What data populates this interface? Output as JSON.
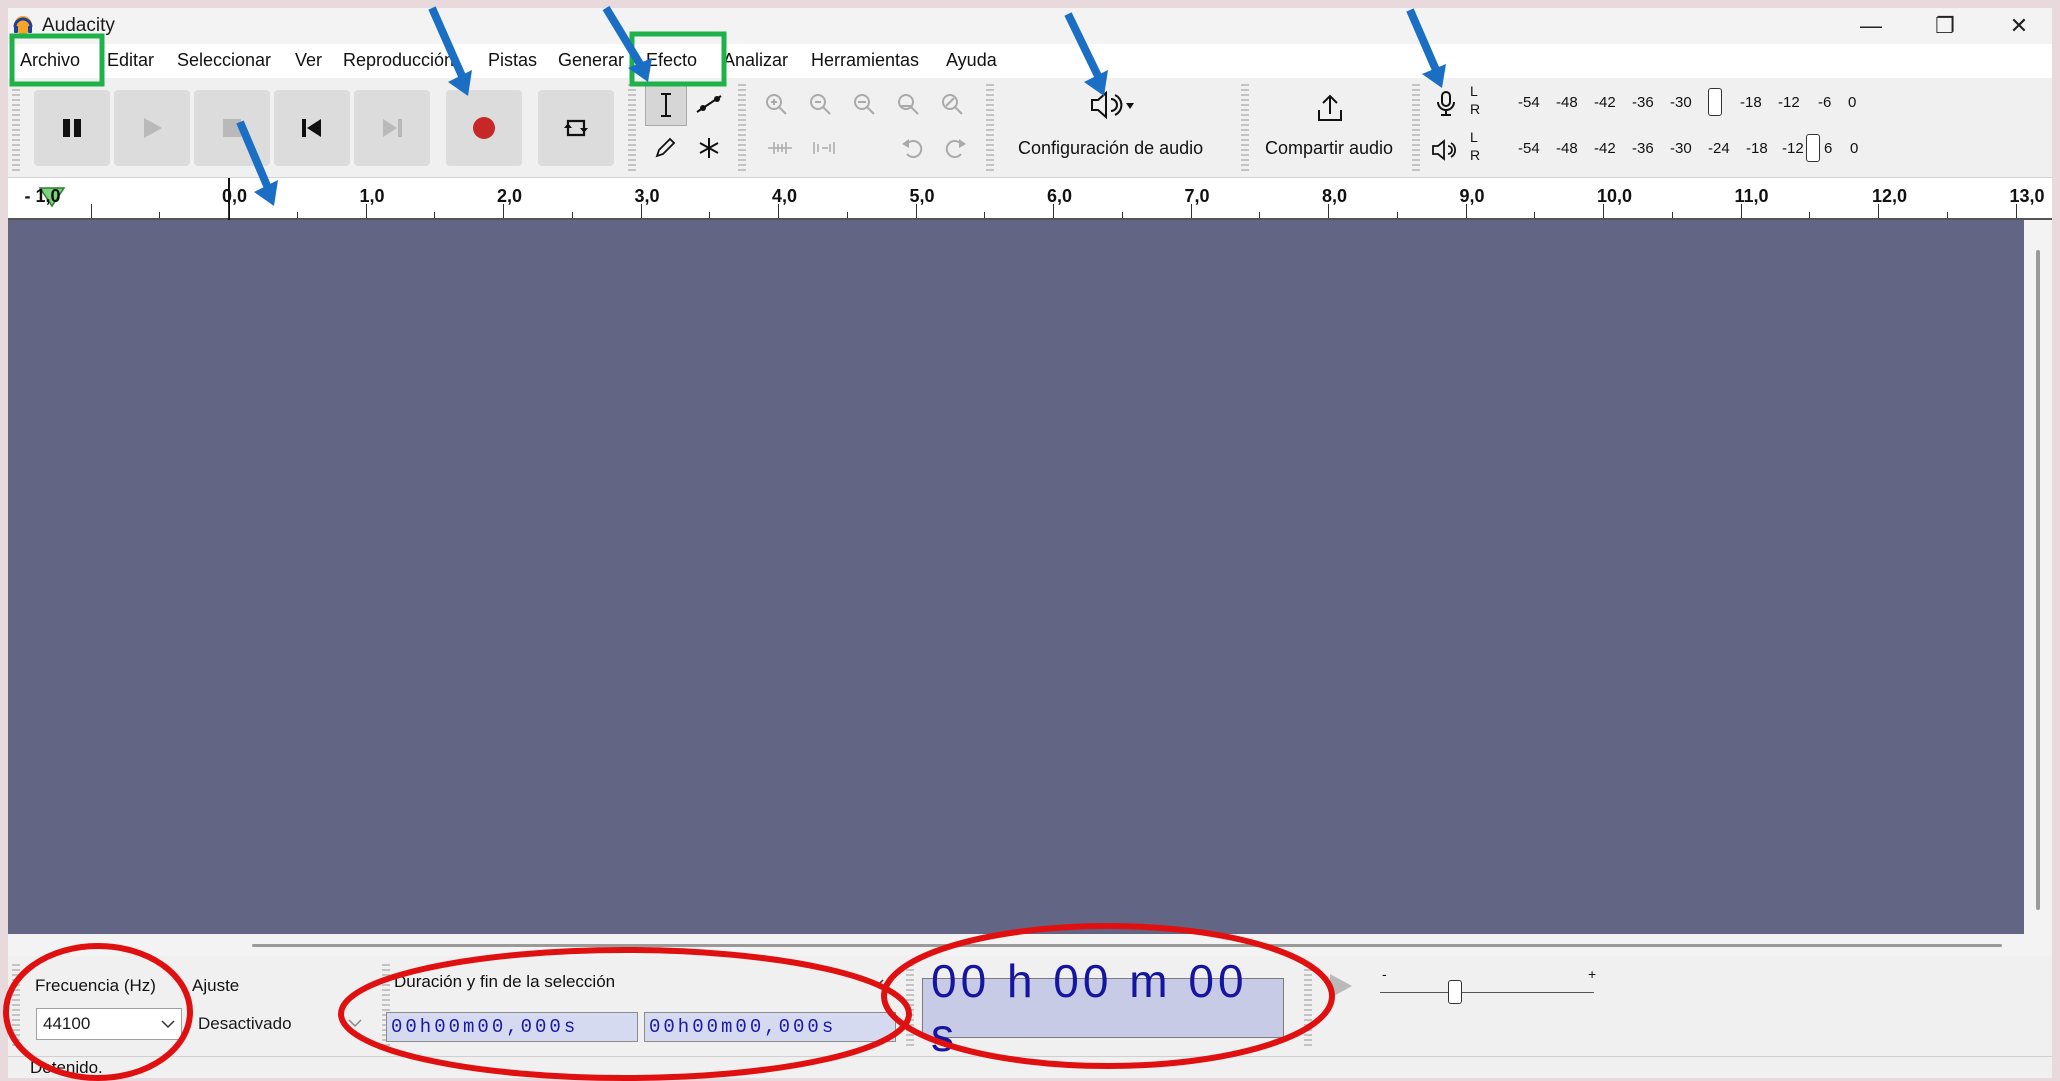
{
  "app": {
    "title": "Audacity"
  },
  "window_controls": {
    "minimize": "—",
    "restore": "❐",
    "close": "✕"
  },
  "menu": [
    "Archivo",
    "Editar",
    "Seleccionar",
    "Ver",
    "Reproducción",
    "Pistas",
    "Generar",
    "Efecto",
    "Analizar",
    "Herramientas",
    "Ayuda"
  ],
  "toolbar": {
    "audio_setup_label": "Configuración de audio",
    "share_audio_label": "Compartir audio",
    "record_meter_scale": [
      "-54",
      "-48",
      "-42",
      "-36",
      "-30",
      "-18",
      "-12",
      "-6",
      "0"
    ],
    "play_meter_scale": [
      "-54",
      "-48",
      "-42",
      "-36",
      "-30",
      "-24",
      "-18",
      "-12",
      "6",
      "0"
    ],
    "meter_channels": [
      "L",
      "R"
    ]
  },
  "ruler": {
    "labels": [
      "- 1,0",
      "0,0",
      "1,0",
      "2,0",
      "3,0",
      "4,0",
      "5,0",
      "6,0",
      "7,0",
      "8,0",
      "9,0",
      "10,0",
      "11,0",
      "12,0",
      "13,0"
    ]
  },
  "bottom": {
    "rate_label": "Frecuencia (Hz)",
    "rate_value": "44100",
    "snap_label": "Ajuste",
    "snap_value": "Desactivado",
    "selection_label": "Duración y fin de la selección",
    "selection_start": "00h00m00,000s",
    "selection_end": "00h00m00,000s",
    "big_time": "00 h 00 m 00 s",
    "speed_min": "-",
    "speed_max": "+"
  },
  "status": {
    "text": "Detenido."
  },
  "colors": {
    "track_bg": "#636584",
    "annotation_blue": "#1a6fc4",
    "annotation_green": "#1fb24a",
    "annotation_red": "#e01010",
    "record_red": "#c62828"
  }
}
